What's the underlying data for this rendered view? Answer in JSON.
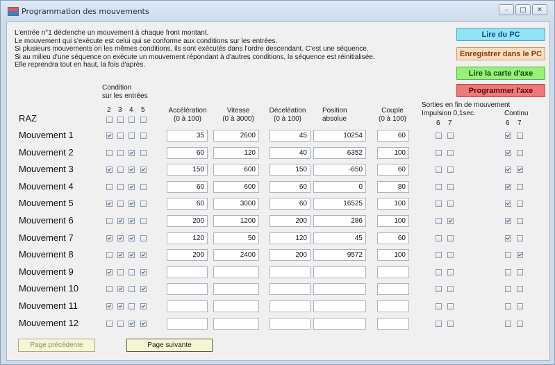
{
  "window": {
    "title": "Programmation des mouvements"
  },
  "info_lines": [
    "L'entrée n°1 déclenche un mouvement à chaque front montant.",
    "Le mouvement qui s'exécute est celui qui se conforme aux conditions sur les entrées.",
    "Si plusieurs mouvements on les mêmes conditions, ils sont exécutés dans l'ordre descendant. C'est une séquence.",
    "Si au milieu d'une séquence on exécute un mouvement répondant à d'autres conditions, la séquence est réinitialisée.",
    "Elle reprendra tout en haut, la fois d'après."
  ],
  "buttons": {
    "read_pc": "Lire du PC",
    "save_pc": "Enregistrer dans le PC",
    "read_card": "Lire la carte d'axe",
    "program_axis": "Programmer l'axe",
    "prev_page": "Page précédente",
    "next_page": "Page suivante"
  },
  "headers": {
    "condition_line1": "Condition",
    "condition_line2": "sur les entrées",
    "raz": "RAZ",
    "input_nums": [
      "2",
      "3",
      "4",
      "5"
    ],
    "accel_1": "Accélération",
    "accel_2": "(0 à 100)",
    "speed_1": "Vitesse",
    "speed_2": "(0 à 3000)",
    "decel_1": "Déceléation",
    "decel_2": "(0 à 100)",
    "pos_1": "Position",
    "pos_2": "absolue",
    "torque_1": "Couple",
    "torque_2": "(0 à 100)",
    "outputs_title": "Sorties en fin de mouvement",
    "pulse": "Impulsion 0,1sec.",
    "continuous": "Continu",
    "out_nums": [
      "6",
      "7"
    ]
  },
  "raz_checks": [
    false,
    false,
    false,
    false
  ],
  "rows": [
    {
      "label": "Mouvement 1",
      "cond": [
        true,
        false,
        false,
        false
      ],
      "accel": "35",
      "speed": "2600",
      "decel": "45",
      "pos": "10254",
      "torque": "60",
      "pulse": [
        false,
        false
      ],
      "cont": [
        true,
        false
      ]
    },
    {
      "label": "Mouvement 2",
      "cond": [
        false,
        false,
        true,
        false
      ],
      "accel": "60",
      "speed": "120",
      "decel": "40",
      "pos": "6352",
      "torque": "100",
      "pulse": [
        false,
        false
      ],
      "cont": [
        true,
        false
      ]
    },
    {
      "label": "Mouvement 3",
      "cond": [
        true,
        false,
        true,
        true
      ],
      "accel": "150",
      "speed": "600",
      "decel": "150",
      "pos": "-650",
      "torque": "60",
      "pulse": [
        false,
        false
      ],
      "cont": [
        true,
        true
      ]
    },
    {
      "label": "Mouvement 4",
      "cond": [
        false,
        false,
        true,
        false
      ],
      "accel": "60",
      "speed": "600",
      "decel": "60",
      "pos": "0",
      "torque": "80",
      "pulse": [
        false,
        false
      ],
      "cont": [
        true,
        false
      ]
    },
    {
      "label": "Mouvement 5",
      "cond": [
        true,
        false,
        true,
        false
      ],
      "accel": "60",
      "speed": "3000",
      "decel": "60",
      "pos": "16525",
      "torque": "100",
      "pulse": [
        false,
        false
      ],
      "cont": [
        true,
        false
      ]
    },
    {
      "label": "Mouvement 6",
      "cond": [
        false,
        true,
        true,
        false
      ],
      "accel": "200",
      "speed": "1200",
      "decel": "200",
      "pos": "286",
      "torque": "100",
      "pulse": [
        false,
        true
      ],
      "cont": [
        true,
        false
      ]
    },
    {
      "label": "Mouvement 7",
      "cond": [
        true,
        true,
        true,
        false
      ],
      "accel": "120",
      "speed": "50",
      "decel": "120",
      "pos": "45",
      "torque": "60",
      "pulse": [
        false,
        false
      ],
      "cont": [
        true,
        false
      ]
    },
    {
      "label": "Mouvement 8",
      "cond": [
        false,
        true,
        true,
        true
      ],
      "accel": "200",
      "speed": "2400",
      "decel": "200",
      "pos": "9572",
      "torque": "100",
      "pulse": [
        false,
        false
      ],
      "cont": [
        false,
        true
      ]
    },
    {
      "label": "Mouvement 9",
      "cond": [
        true,
        false,
        false,
        true
      ],
      "accel": "",
      "speed": "",
      "decel": "",
      "pos": "",
      "torque": "",
      "pulse": [
        false,
        false
      ],
      "cont": [
        false,
        false
      ]
    },
    {
      "label": "Mouvement 10",
      "cond": [
        false,
        true,
        false,
        true
      ],
      "accel": "",
      "speed": "",
      "decel": "",
      "pos": "",
      "torque": "",
      "pulse": [
        false,
        false
      ],
      "cont": [
        false,
        false
      ]
    },
    {
      "label": "Mouvement 11",
      "cond": [
        true,
        true,
        false,
        true
      ],
      "accel": "",
      "speed": "",
      "decel": "",
      "pos": "",
      "torque": "",
      "pulse": [
        false,
        false
      ],
      "cont": [
        false,
        false
      ]
    },
    {
      "label": "Mouvement 12",
      "cond": [
        false,
        false,
        true,
        true
      ],
      "accel": "",
      "speed": "",
      "decel": "",
      "pos": "",
      "torque": "",
      "pulse": [
        false,
        false
      ],
      "cont": [
        false,
        false
      ]
    }
  ]
}
